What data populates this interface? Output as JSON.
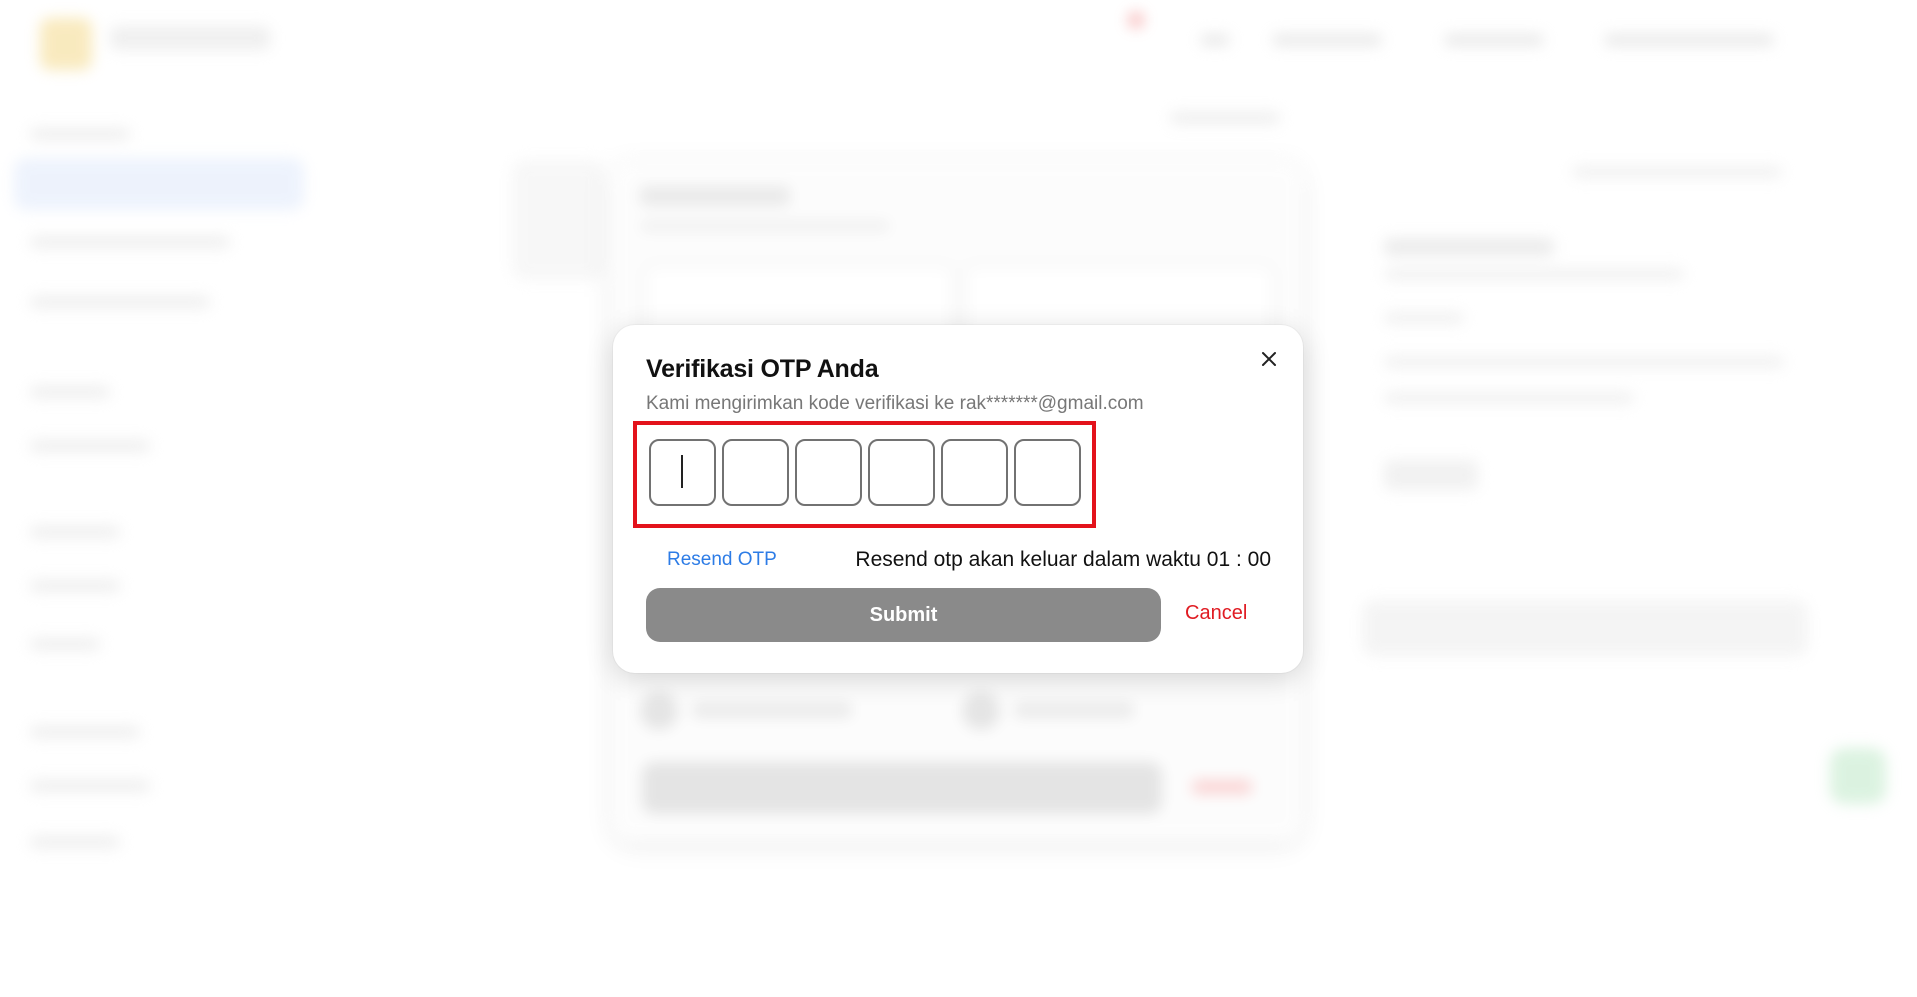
{
  "modal": {
    "title": "Verifikasi OTP Anda",
    "subtitle": "Kami mengirimkan kode verifikasi ke rak*******@gmail.com",
    "close_icon": "close-icon",
    "otp": {
      "digit_count": 6,
      "digits": [
        "",
        "",
        "",
        "",
        "",
        ""
      ],
      "active_index": 0,
      "highlight_color": "#e3121b"
    },
    "resend_label": "Resend OTP",
    "resend_timer_text": "Resend otp akan keluar dalam waktu 01 : 00",
    "submit_label": "Submit",
    "cancel_label": "Cancel"
  },
  "colors": {
    "link": "#2d7ce6",
    "submit_bg": "#8a8a8a",
    "cancel": "#e01b22",
    "highlight": "#e3121b"
  }
}
